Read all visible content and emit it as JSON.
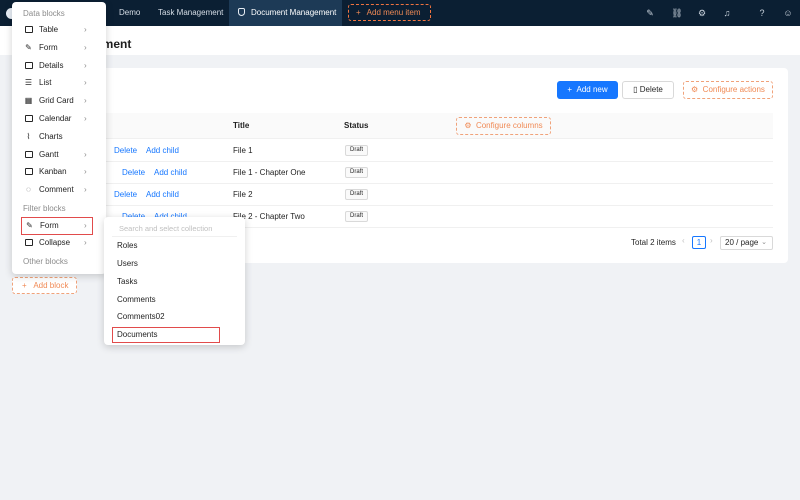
{
  "topbar": {
    "nav": [
      "Demo",
      "Task Management",
      "Document Management"
    ],
    "add_menu_item": "Add menu item",
    "icons": [
      "highlighter-icon",
      "link-icon",
      "settings-icon",
      "bell-icon",
      "help-icon",
      "user-icon"
    ]
  },
  "page": {
    "title": "ement"
  },
  "toolbar": {
    "add_new": "Add new",
    "delete": "Delete",
    "configure_actions": "Configure actions"
  },
  "table": {
    "columns": [
      "Title",
      "Status"
    ],
    "configure_columns": "Configure columns",
    "row_actions": [
      "Delete",
      "Add child"
    ],
    "rows": [
      {
        "title": "File 1",
        "status": "Draft"
      },
      {
        "title": "File 1 - Chapter One",
        "status": "Draft"
      },
      {
        "title": "File 2",
        "status": "Draft"
      },
      {
        "title": "File 2 - Chapter Two",
        "status": "Draft"
      }
    ]
  },
  "pagination": {
    "total": "Total 2 items",
    "current_page": "1",
    "page_size": "20 / page"
  },
  "add_block": "Add block",
  "block_menu": {
    "data_blocks_title": "Data blocks",
    "data_blocks": [
      "Table",
      "Form",
      "Details",
      "List",
      "Grid Card",
      "Calendar",
      "Charts",
      "Gantt",
      "Kanban",
      "Comment"
    ],
    "filter_blocks_title": "Filter blocks",
    "filter_blocks": [
      "Form",
      "Collapse"
    ],
    "other_blocks_title": "Other blocks"
  },
  "collection_menu": {
    "search_placeholder": "Search and select collection",
    "items": [
      "Roles",
      "Users",
      "Tasks",
      "Comments",
      "Comments02",
      "Documents"
    ]
  },
  "colors": {
    "topbar": "#0b1f33",
    "primary": "#1677ff",
    "accent": "#f08a55",
    "highlight": "#e14b4b"
  }
}
